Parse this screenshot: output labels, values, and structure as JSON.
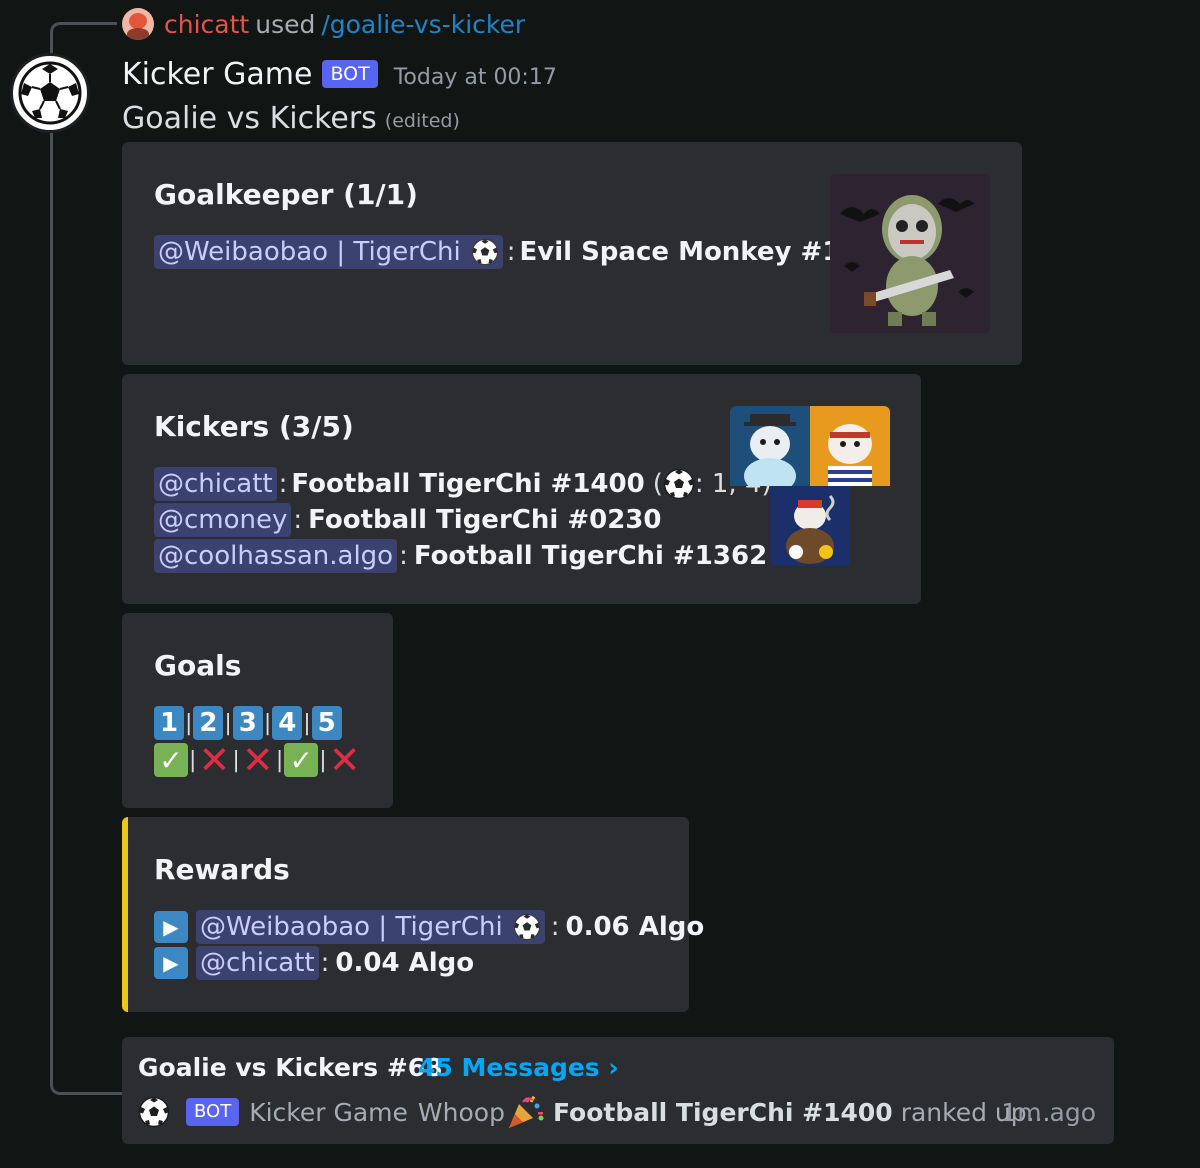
{
  "reply": {
    "user": "chicatt",
    "used_text": "used",
    "command": "/goalie-vs-kicker"
  },
  "message": {
    "author": "Kicker Game",
    "bot_tag": "BOT",
    "timestamp": "Today at 00:17",
    "content": "Goalie vs Kickers",
    "edited": "(edited)"
  },
  "goalkeeper": {
    "title": "Goalkeeper (1/1)",
    "mention": "@Weibaobao | TigerChi",
    "colon": ":",
    "nft": "Evil Space Monkey #109"
  },
  "kickers": {
    "title": "Kickers (3/5)",
    "rows": [
      {
        "mention": "@chicatt",
        "colon": ":",
        "nft": "Football TigerChi #1400",
        "extra_open": "(",
        "extra_rest": ": 1, 4)"
      },
      {
        "mention": "@cmoney",
        "colon": ":",
        "nft": "Football TigerChi #0230"
      },
      {
        "mention": "@coolhassan.algo",
        "colon": ":",
        "nft": "Football TigerChi #1362"
      }
    ]
  },
  "goals": {
    "title": "Goals",
    "numbers": [
      "1",
      "2",
      "3",
      "4",
      "5"
    ],
    "results": [
      "check",
      "cross",
      "cross",
      "check",
      "cross"
    ]
  },
  "rewards": {
    "title": "Rewards",
    "accent_color": "#f0c419",
    "rows": [
      {
        "mention": "@Weibaobao | TigerChi",
        "colon": ":",
        "amount": "0.06 Algo"
      },
      {
        "mention": "@chicatt",
        "colon": ":",
        "amount": "0.04 Algo"
      }
    ]
  },
  "thread": {
    "title": "Goalie vs Kickers #68",
    "count": "45 Messages ›",
    "bot_tag": "BOT",
    "author": "Kicker Game",
    "preview_pre": "Whoop",
    "preview_bold": "Football TigerChi #1400",
    "preview_post": "ranked up...",
    "time": "1m ago"
  },
  "colors": {
    "mention_bg": "#3c4270",
    "mention_text": "#c9cdfb",
    "link": "#00a8fc",
    "bot_tag": "#5865f2",
    "embed_bg": "#2b2d31",
    "page_bg": "#111614"
  },
  "icons": [
    "soccer-ball-icon",
    "party-popper-icon",
    "play-button-icon",
    "check-mark-icon",
    "cross-mark-icon",
    "keycap-digit-icon"
  ]
}
